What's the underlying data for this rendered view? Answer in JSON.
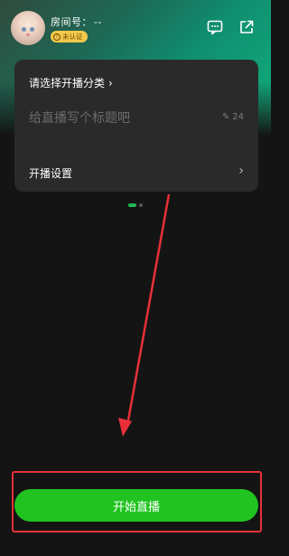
{
  "header": {
    "avatar_icon": "cat-avatar-icon",
    "room_label": "房间号：",
    "room_value": "--",
    "badge_text": "未认证",
    "badge_color": "#f3c94c",
    "icons": [
      "chat-icon",
      "share-icon"
    ]
  },
  "panel": {
    "category_label": "请选择开播分类",
    "title_placeholder": "给直播写个标题吧",
    "title_value": "",
    "char_counter": "24",
    "settings_label": "开播设置"
  },
  "pager": {
    "active_index": 0,
    "total": 2
  },
  "footer": {
    "start_button_label": "开始直播",
    "start_button_color": "#20c31f",
    "highlight_color": "#e8303a"
  }
}
